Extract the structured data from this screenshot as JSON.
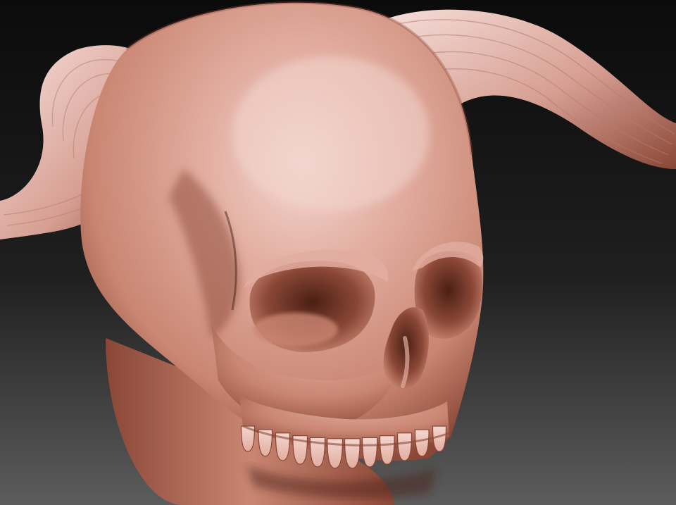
{
  "scene": {
    "subject": "horned-skull-sculpt",
    "colors": {
      "background_top": "#0b0b0b",
      "background_mid": "#1f1f1f",
      "background_bottom": "#5c5c5c",
      "clay_highlight": "#f3d6cf",
      "clay_light": "#e2ada0",
      "clay_mid": "#c98672",
      "clay_shadow": "#8a4736",
      "clay_deep": "#4a1f14",
      "horn_light": "#f6dfda",
      "horn_mid": "#d79f93"
    }
  }
}
